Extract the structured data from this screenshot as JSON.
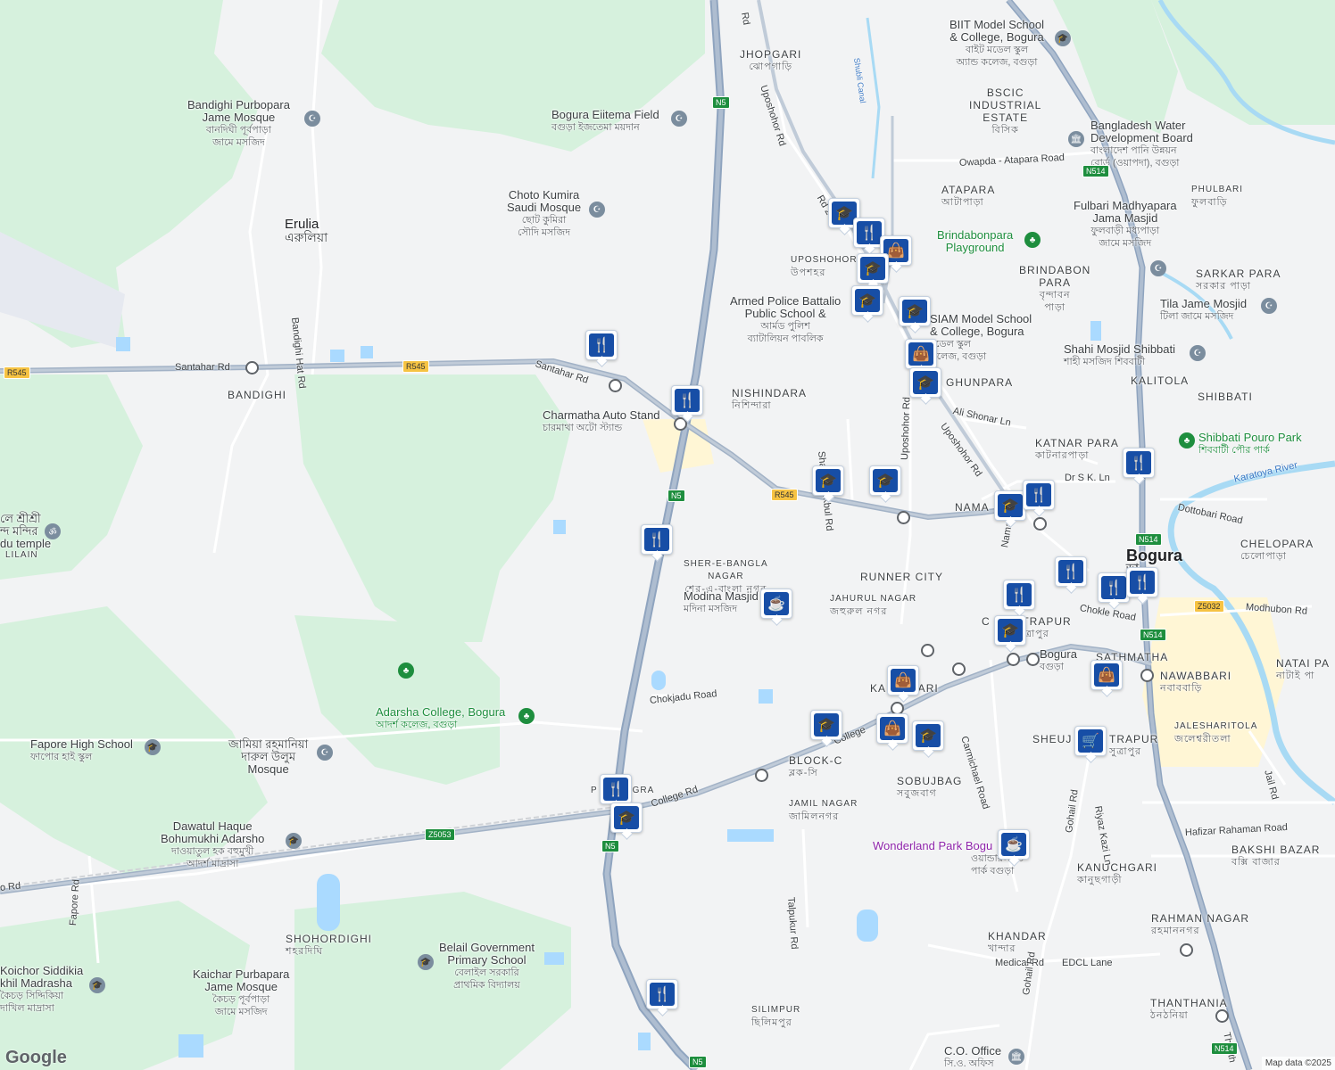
{
  "map": {
    "attribution": "Map data ©2025",
    "logo": "Google",
    "places": [
      {
        "id": "erulia",
        "en": "Erulia",
        "bn": "এরুলিয়া",
        "kind": "town"
      },
      {
        "id": "bogura",
        "en": "Bogura",
        "bn": "ড়া",
        "kind": "city"
      },
      {
        "id": "jhopgari",
        "en": "JHOPGARI",
        "bn": "ঝোপগাড়ি",
        "kind": "area"
      },
      {
        "id": "bscic",
        "en": "BSCIC\nINDUSTRIAL\nESTATE",
        "bn": "বিসিক",
        "kind": "area"
      },
      {
        "id": "atapara",
        "en": "ATAPARA",
        "bn": "আটাপাড়া",
        "kind": "area"
      },
      {
        "id": "phulbari",
        "en": "PHULBARI",
        "bn": "ফুলবাড়ি",
        "kind": "area-small"
      },
      {
        "id": "brindabon",
        "en": "BRINDABON\nPARA",
        "bn": "বৃন্দাবন\nপাড়া",
        "kind": "area"
      },
      {
        "id": "sarkar",
        "en": "SARKAR PARA",
        "bn": "সরকার পাড়া",
        "kind": "area"
      },
      {
        "id": "uposhohor",
        "en": "UPOSHOHOR",
        "bn": "উপশহর",
        "kind": "area-small"
      },
      {
        "id": "nishindara",
        "en": "NISHINDARA",
        "bn": "নিশিন্দারা",
        "kind": "area"
      },
      {
        "id": "ghunpara",
        "en": "GHUNPARA",
        "bn": "",
        "kind": "area"
      },
      {
        "id": "kalitola",
        "en": "KALITOLA",
        "bn": "",
        "kind": "area"
      },
      {
        "id": "shibbati",
        "en": "SHIBBATI",
        "bn": "",
        "kind": "area"
      },
      {
        "id": "katnar",
        "en": "KATNAR PARA",
        "bn": "কাটনারপাড়া",
        "kind": "area"
      },
      {
        "id": "bandighi",
        "en": "BANDIGHI",
        "bn": "",
        "kind": "area"
      },
      {
        "id": "lilain",
        "en": "LILAIN",
        "bn": "",
        "kind": "area-small"
      },
      {
        "id": "sherebangla",
        "en": "SHER-E-BANGLA\nNAGAR",
        "bn": "শের-এ-বাংলা নগর",
        "kind": "area-small"
      },
      {
        "id": "runner",
        "en": "RUNNER CITY",
        "bn": "",
        "kind": "area"
      },
      {
        "id": "jahurul",
        "en": "JAHURUL NAGAR",
        "bn": "জহুরুল নগর",
        "kind": "area-small"
      },
      {
        "id": "chelopara",
        "en": "CHELOPARA",
        "bn": "চেলোপাড়া",
        "kind": "area"
      },
      {
        "id": "sathmatha",
        "en": "SATHMATHA",
        "bn": "",
        "kind": "area"
      },
      {
        "id": "nawabbari",
        "en": "NAWABBARI",
        "bn": "নবাববাড়ি",
        "kind": "area"
      },
      {
        "id": "nataipa",
        "en": "NATAI PA",
        "bn": "নাটাই পা",
        "kind": "area"
      },
      {
        "id": "kalogari",
        "en": "KA      GARI",
        "bn": "",
        "kind": "area"
      },
      {
        "id": "chutrapur",
        "en": "C      UTRAPUR",
        "bn": "ত্রাপুর",
        "kind": "area"
      },
      {
        "id": "sheujgari",
        "en": "SHEUJ",
        "bn": "",
        "kind": "area"
      },
      {
        "id": "sutrapur",
        "en": "TRAPUR",
        "bn": "সুত্রাপুর",
        "kind": "area"
      },
      {
        "id": "jaleshari",
        "en": "JALESHARITOLA",
        "bn": "জলেশ্বরীতলা",
        "kind": "area-small"
      },
      {
        "id": "blockc",
        "en": "BLOCK-C",
        "bn": "ব্লক-সি",
        "kind": "area"
      },
      {
        "id": "sobujbag",
        "en": "SOBUJBAG",
        "bn": "সবুজবাগ",
        "kind": "area"
      },
      {
        "id": "jamilnagar",
        "en": "JAMIL NAGAR",
        "bn": "জামিলনগর",
        "kind": "area-small"
      },
      {
        "id": "pbogra",
        "en": "P      BOGRA",
        "bn": "",
        "kind": "area-small"
      },
      {
        "id": "kanuchgari",
        "en": "KANUCHGARI",
        "bn": "কানুছগাড়ী",
        "kind": "area"
      },
      {
        "id": "bakshi",
        "en": "BAKSHI BAZAR",
        "bn": "বক্সি বাজার",
        "kind": "area"
      },
      {
        "id": "rahman",
        "en": "RAHMAN NAGAR",
        "bn": "রহমাননগর",
        "kind": "area"
      },
      {
        "id": "khandar",
        "en": "KHANDAR",
        "bn": "খান্দার",
        "kind": "area"
      },
      {
        "id": "thanthania",
        "en": "THANTHANIA",
        "bn": "ঠনঠনিয়া",
        "kind": "area"
      },
      {
        "id": "shohordighi",
        "en": "SHOHORDIGHI",
        "bn": "শহরদিঘি",
        "kind": "area"
      },
      {
        "id": "silimpur",
        "en": "SILIMPUR",
        "bn": "ছিলিমপুর",
        "kind": "area-small"
      },
      {
        "id": "namaj",
        "en": "NAMA",
        "bn": "",
        "kind": "area"
      }
    ],
    "pois": [
      {
        "id": "biit",
        "en": "BIIT Model School\n& College, Bogura",
        "bn": "বাইট মডেল স্কুল\nঅ্যান্ড কলেজ, বগুড়া",
        "icon": "school"
      },
      {
        "id": "eiitema",
        "en": "Bogura Eiitema Field",
        "bn": "বগুড়া ইজতেমা ময়দান",
        "icon": "mosque"
      },
      {
        "id": "bandighi_mosque",
        "en": "Bandighi Purbopara\nJame Mosque",
        "bn": "বানদিঘী পূর্বপাড়া\nজামে মসজিদ",
        "icon": "mosque"
      },
      {
        "id": "choto",
        "en": "Choto Kumira\nSaudi Mosque",
        "bn": "ছোট কুমিরা\nসৌদি মসজিদ",
        "icon": "mosque"
      },
      {
        "id": "bwdb",
        "en": "Bangladesh Water\nDevelopment Board",
        "bn": "বাংলাদেশ পানি উন্নয়ন\nবোর্ড (ওয়াপদা), বগুড়া",
        "icon": "gov"
      },
      {
        "id": "fulbari",
        "en": "Fulbari Madhyapara\nJama Masjid",
        "bn": "ফুলবাড়ী মধ্যপাড়া\nজামে মসজিদ",
        "icon": "mosque"
      },
      {
        "id": "brindabon_pg",
        "en": "Brindabonpara\nPlayground",
        "bn": "",
        "icon": "park"
      },
      {
        "id": "armed",
        "en": "Armed Police Battalio\nPublic School &",
        "bn": "আর্মড পুলিশ\nব্যাটালিয়ন পাবলিক",
        "icon": "school"
      },
      {
        "id": "siam",
        "en": "SIAM Model School\n& College, Bogura",
        "bn": "মডেল স্কুল\nকলেজ, বগুড়া",
        "icon": "school"
      },
      {
        "id": "tila",
        "en": "Tila Jame Mosjid",
        "bn": "টিলা জামে মসজিদ",
        "icon": "mosque"
      },
      {
        "id": "shahi",
        "en": "Shahi Mosjid Shibbati",
        "bn": "শাহী মসজিদ শিববাটী",
        "icon": "mosque"
      },
      {
        "id": "charmatha",
        "en": "Charmatha Auto Stand",
        "bn": "চারমাথা অটো স্ট্যান্ড",
        "icon": "bus"
      },
      {
        "id": "shibbati_park",
        "en": "Shibbati Pouro Park",
        "bn": "শিববাটী পৌর পার্ক",
        "icon": "park"
      },
      {
        "id": "madina",
        "en": "Modina Masjid",
        "bn": "মদিনা মসজিদ",
        "icon": "mosque"
      },
      {
        "id": "adarsha",
        "en": "Adarsha College, Bogura",
        "bn": "আদর্শ কলেজ, বগুড়া",
        "icon": "park"
      },
      {
        "id": "fapore",
        "en": "Fapore High School",
        "bn": "ফাপোর হাই স্কুল",
        "icon": "school"
      },
      {
        "id": "jamia",
        "en": "জামিয়া রহমানিয়া\nদারুল উলুম\nMosque",
        "bn": "",
        "icon": "mosque"
      },
      {
        "id": "dawatul",
        "en": "Dawatul Haque\nBohumukhi Adarsho",
        "bn": "দাওয়াতুল হক বহুমুখী\nআদর্শ মাদ্রাসা",
        "icon": "school"
      },
      {
        "id": "hindu",
        "en": "লে শ্রীশ্রী\nন্দ মন্দির\ndu temple",
        "bn": "",
        "icon": "temple"
      },
      {
        "id": "wonderland",
        "en": "Wonderland Park Bogu",
        "bn": "ওয়ান্ডারল্যান্ড\nপার্ক বগুড়া",
        "icon": "cafe"
      },
      {
        "id": "belail",
        "en": "Belail Government\nPrimary School",
        "bn": "বেলাইল সরকারি\nপ্রাথমিক বিদ্যালয়",
        "icon": "school"
      },
      {
        "id": "kaichor",
        "en": "Kaichar Purbapara\nJame Mosque",
        "bn": "কৈচড় পূর্বপাড়া\nজামে মসজিদ",
        "icon": "mosque"
      },
      {
        "id": "koichor_madrasha",
        "en": "Koichor Siddikia\nkhil Madrasha",
        "bn": "কৈচড় সিদ্দিকিয়া\nদাখিল মাদ্রাসা",
        "icon": "school"
      },
      {
        "id": "bogura_station",
        "en": "Bogura",
        "bn": "বগুড়া",
        "icon": "train"
      },
      {
        "id": "co_office",
        "en": "C.O. Office",
        "bn": "সি.ও. অফিস",
        "icon": "gov"
      },
      {
        "id": "medical_rd",
        "en": "Medical Rd",
        "bn": "",
        "icon": "none"
      }
    ],
    "roads": [
      {
        "id": "santahar1",
        "name": "Santahar Rd"
      },
      {
        "id": "santahar2",
        "name": "Santahar Rd"
      },
      {
        "id": "uposhohor1",
        "name": "Uposhohor Rd"
      },
      {
        "id": "uposhohor2",
        "name": "Uposhohor Rd"
      },
      {
        "id": "uposhohor3",
        "name": "Uposhohor Rd"
      },
      {
        "id": "owapda",
        "name": "Owapda - Atapara Road"
      },
      {
        "id": "alishonar",
        "name": "Ali Shonar Ln"
      },
      {
        "id": "drsk",
        "name": "Dr S K. Ln"
      },
      {
        "id": "dottobari",
        "name": "Dottobari Road"
      },
      {
        "id": "karatoya",
        "name": "Karatoya River"
      },
      {
        "id": "modhubon",
        "name": "Modhubon Rd"
      },
      {
        "id": "chokjadu",
        "name": "Chokjadu Road"
      },
      {
        "id": "college1",
        "name": "College Rd"
      },
      {
        "id": "college2",
        "name": "College"
      },
      {
        "id": "carmichael",
        "name": "Carmichael Road"
      },
      {
        "id": "gohail1",
        "name": "Gohail Rd"
      },
      {
        "id": "gohail2",
        "name": "Gohail Rd"
      },
      {
        "id": "riyaz",
        "name": "Riyaz Kazi Ln"
      },
      {
        "id": "hafizar",
        "name": "Hafizar Rahaman Road"
      },
      {
        "id": "jail",
        "name": "Jail Rd"
      },
      {
        "id": "talpukur",
        "name": "Talpukur Rd"
      },
      {
        "id": "fapore_rd",
        "name": "Fapore Rd"
      },
      {
        "id": "bandighi_hat",
        "name": "Bandighi Hat Rd"
      },
      {
        "id": "shahid",
        "name": "Shahid Mokbul Rd"
      },
      {
        "id": "edcl",
        "name": "EDCL Lane"
      },
      {
        "id": "shubli",
        "name": "Shubli Canal"
      },
      {
        "id": "chokle",
        "name": "Chokle Road"
      },
      {
        "id": "road_west",
        "name": "o Rd"
      },
      {
        "id": "rd2",
        "name": "Rd 2"
      },
      {
        "id": "rd_top",
        "name": "Rd"
      },
      {
        "id": "thanthania_rd",
        "name": "Thanth"
      },
      {
        "id": "namaj_rd",
        "name": "Namaj"
      }
    ],
    "shields": [
      {
        "id": "r545a",
        "label": "R545"
      },
      {
        "id": "r545b",
        "label": "R545"
      },
      {
        "id": "r545c",
        "label": "R545"
      },
      {
        "id": "n5a",
        "label": "N5"
      },
      {
        "id": "n5b",
        "label": "N5"
      },
      {
        "id": "n5c",
        "label": "N5"
      },
      {
        "id": "n5d",
        "label": "N5"
      },
      {
        "id": "n514a",
        "label": "N514"
      },
      {
        "id": "n514b",
        "label": "N514"
      },
      {
        "id": "n514c",
        "label": "N514"
      },
      {
        "id": "n514d",
        "label": "N514"
      },
      {
        "id": "z5032",
        "label": "Z5032"
      },
      {
        "id": "z5053",
        "label": "Z5053"
      }
    ]
  }
}
